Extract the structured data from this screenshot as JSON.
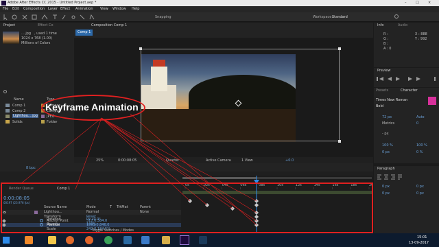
{
  "titlebar": {
    "title": "Adobe After Effects CC 2015 - Untitled Project.aep *",
    "controls": [
      "–",
      "□",
      "×"
    ]
  },
  "menu": [
    "File",
    "Edit",
    "Composition",
    "Layer",
    "Effect",
    "Animation",
    "View",
    "Window",
    "Help"
  ],
  "toolbar": {
    "snapping": "Snapping",
    "workspace_label": "Workspace:",
    "workspace_value": "Standard"
  },
  "project_panel": {
    "tab": "Project",
    "effect_tab": "Effect Co",
    "item_name": "....jpg",
    "item_used": ", used 1 time",
    "item_dims": "1024 x 768 (1.00)",
    "item_colors": "Millions of Colors",
    "columns": {
      "name": "Name",
      "type": "Type"
    },
    "items": [
      {
        "name": "Comp 1",
        "type": "Compos"
      },
      {
        "name": "Comp 2",
        "type": "Compos"
      },
      {
        "name": "Lighthou....jpg",
        "type": "JPEG"
      },
      {
        "name": "Solids",
        "type": "Folder"
      }
    ],
    "bpc": "8 bpc"
  },
  "composition": {
    "tab": "Composition Comp 1",
    "subtab": "Comp 1",
    "zoom": "25%",
    "timecode": "0:00:08:05",
    "resolution": "Quarter",
    "camera": "Active Camera",
    "view": "1 View",
    "exposure": "+0.0"
  },
  "overlay_label": "Keyframe Animation",
  "info_panel": {
    "tab": "Info",
    "audio_tab": "Audio",
    "r": "R :",
    "g": "G :",
    "b": "B :",
    "a": "A : 0",
    "x": "X : 888",
    "y": "Y : 992"
  },
  "preview_panel": {
    "tab": "Preview"
  },
  "character_panel": {
    "tab": "Character",
    "presets_tab": "Presets",
    "font": "Times New Roman",
    "style": "Bold",
    "size": "72 px",
    "leading": "Auto",
    "metrics": "Metrics",
    "tracking": "0",
    "stroke": "- px",
    "vscale": "100 %",
    "hscale": "100 %",
    "baseline": "0 px",
    "tsume": "0 %"
  },
  "paragraph_panel": {
    "tab": "Paragraph",
    "indent1": "0 px",
    "indent2": "0 px",
    "space1": "0 px",
    "space2": "0 px"
  },
  "timeline": {
    "render_tab": "Render Queue",
    "comp_tab": "Comp 1",
    "timecode": "0:00:08:05",
    "frames": "00197 (23.976 fps)",
    "col_source": "Source Name",
    "col_mode": "Mode",
    "col_t": "T",
    "col_trkmat": "TrkMat",
    "col_parent": "Parent",
    "layer_name": "Lighthou...",
    "layer_mode": "Normal",
    "layer_parent": "None",
    "transform": "Transform",
    "reset": "Reset",
    "properties": [
      {
        "name": "Anchor Point",
        "value": "512.0,384.0"
      },
      {
        "name": "Position",
        "value": "1591.0,846.0"
      },
      {
        "name": "Scale",
        "value": "242.0,184.5%"
      },
      {
        "name": "Rotation",
        "value": "0x+0.0°"
      },
      {
        "name": "Opacity",
        "value": "100%"
      }
    ],
    "ruler": [
      "0s",
      "02s",
      "04s",
      "06s",
      "08s",
      "10s",
      "12s",
      "14s",
      "16s",
      "18s",
      "20s"
    ],
    "toggle": "Toggle Switches / Modes"
  },
  "taskbar": {
    "time": "15:01",
    "date": "13-09-2017"
  },
  "colors": {
    "accent": "#2d8ceb",
    "annotation": "#e02020",
    "keyframe": "#c9c9c9",
    "playhead": "#2d8ceb",
    "bar": "#3c4a30"
  }
}
